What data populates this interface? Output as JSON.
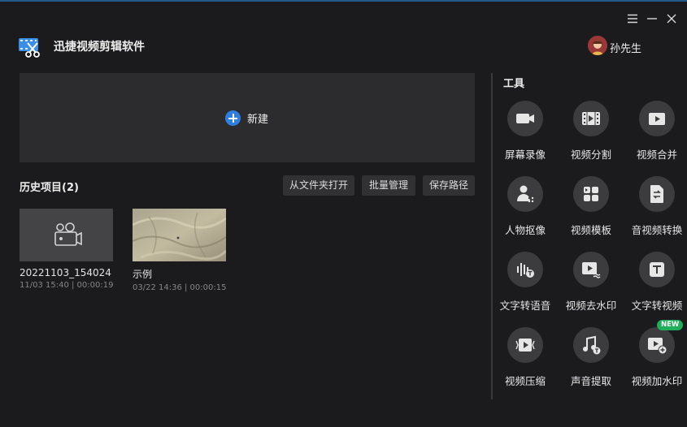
{
  "app": {
    "title": "迅捷视频剪辑软件"
  },
  "user": {
    "name": "孙先生"
  },
  "window_controls": [
    "menu-icon",
    "minimize-icon",
    "close-icon"
  ],
  "new_project": {
    "label": "新建",
    "accent": "#2f7fe0"
  },
  "history": {
    "title": "历史项目(2)",
    "buttons": [
      "从文件夹打开",
      "批量管理",
      "保存路径"
    ],
    "projects": [
      {
        "name": "20221103_154024",
        "meta": "11/03 15:40 | 00:00:19",
        "thumb": "camera-icon"
      },
      {
        "name": "示例",
        "meta": "03/22 14:36 | 00:00:15",
        "thumb": "desert-image"
      }
    ]
  },
  "tools": {
    "title": "工具",
    "badge": "NEW",
    "items": [
      {
        "label": "屏幕录像",
        "icon": "screen-record-icon"
      },
      {
        "label": "视频分割",
        "icon": "video-split-icon"
      },
      {
        "label": "视频合并",
        "icon": "video-merge-icon"
      },
      {
        "label": "人物抠像",
        "icon": "person-cutout-icon"
      },
      {
        "label": "视频模板",
        "icon": "video-template-icon"
      },
      {
        "label": "音视频转换",
        "icon": "av-convert-icon"
      },
      {
        "label": "文字转语音",
        "icon": "text-to-speech-icon"
      },
      {
        "label": "视频去水印",
        "icon": "remove-watermark-icon"
      },
      {
        "label": "文字转视频",
        "icon": "text-to-video-icon"
      },
      {
        "label": "视频压缩",
        "icon": "video-compress-icon"
      },
      {
        "label": "声音提取",
        "icon": "audio-extract-icon"
      },
      {
        "label": "视频加水印",
        "icon": "add-watermark-icon"
      }
    ]
  }
}
